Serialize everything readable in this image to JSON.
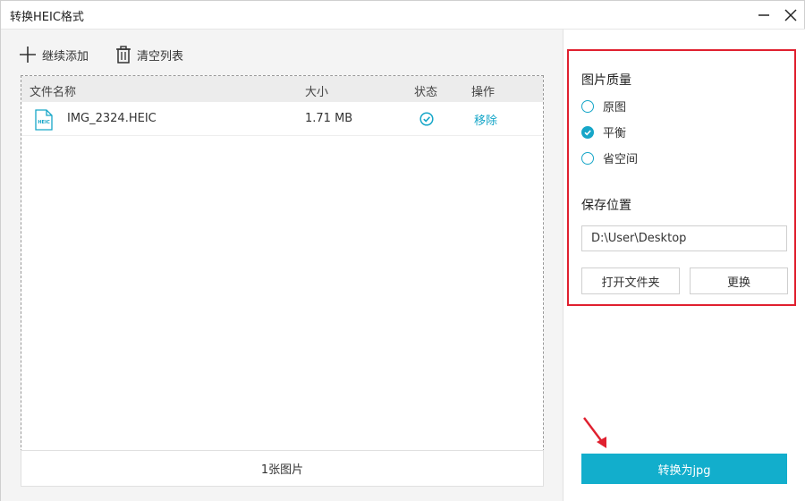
{
  "window": {
    "title": "转换HEIC格式"
  },
  "toolbar": {
    "add_label": "继续添加",
    "clear_label": "清空列表"
  },
  "table": {
    "headers": {
      "name": "文件名称",
      "size": "大小",
      "status": "状态",
      "action": "操作"
    },
    "rows": [
      {
        "name": "IMG_2324.HEIC",
        "size": "1.71 MB",
        "file_icon_text": "HEIC",
        "status_icon": "check-circle-icon",
        "action": "移除"
      }
    ]
  },
  "footer": {
    "count_text": "1张图片"
  },
  "quality": {
    "title": "图片质量",
    "options": [
      {
        "label": "原图",
        "checked": false
      },
      {
        "label": "平衡",
        "checked": true
      },
      {
        "label": "省空间",
        "checked": false
      }
    ]
  },
  "save": {
    "title": "保存位置",
    "path": "D:\\User\\Desktop",
    "open_folder_label": "打开文件夹",
    "change_label": "更换"
  },
  "convert": {
    "label": "转换为jpg"
  },
  "colors": {
    "accent": "#12aecc",
    "highlight": "#e0202f"
  }
}
